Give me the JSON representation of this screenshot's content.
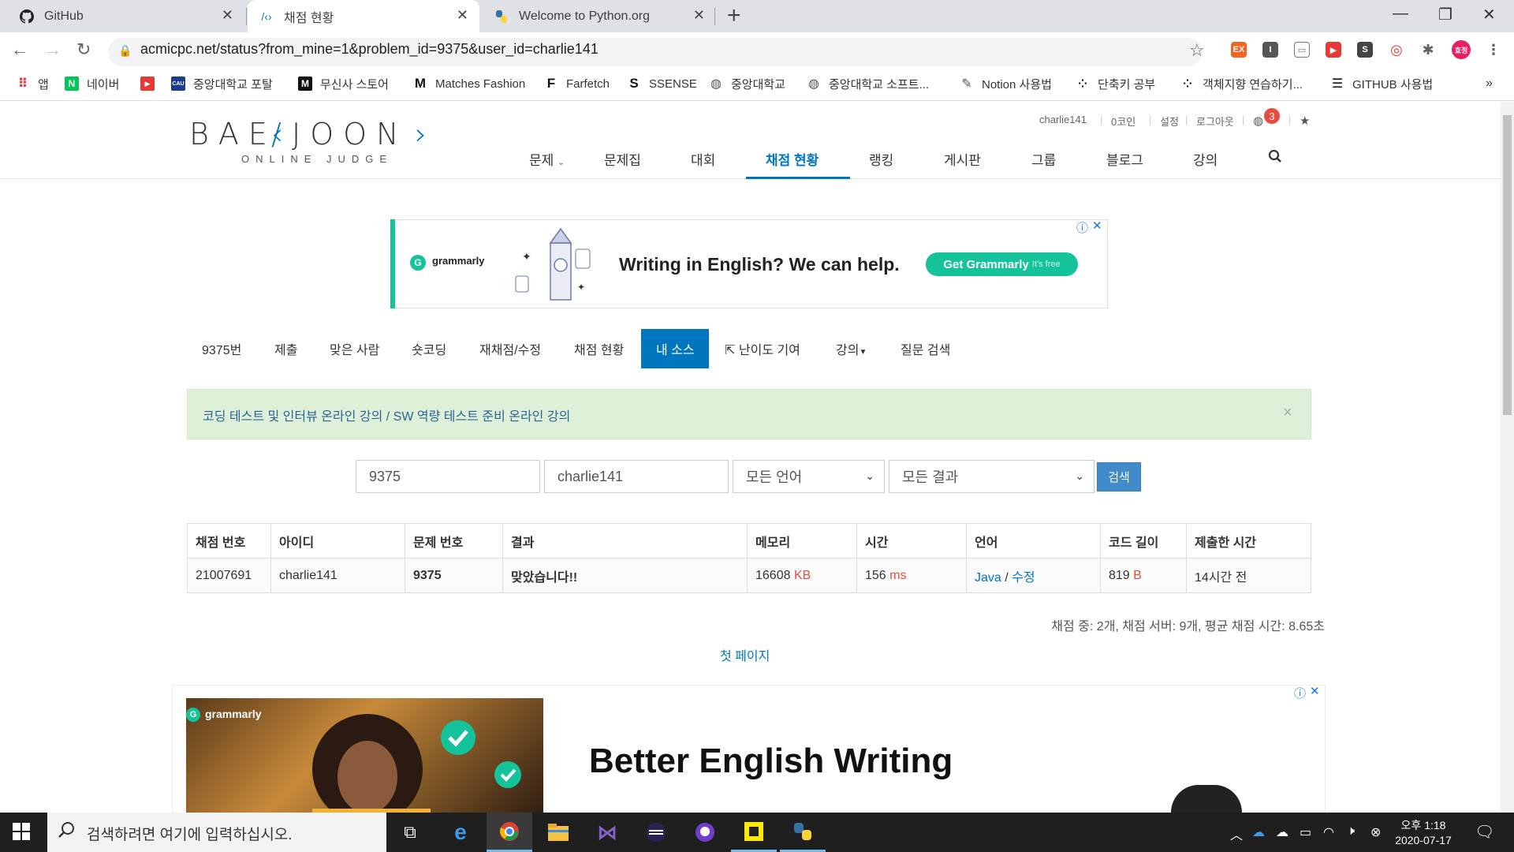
{
  "browser": {
    "tabs": [
      {
        "title": "GitHub",
        "icon": "github-icon",
        "active": false
      },
      {
        "title": "채점 현황",
        "icon": "code-icon",
        "active": true
      },
      {
        "title": "Welcome to Python.org",
        "icon": "python-icon",
        "active": false
      }
    ],
    "url": "acmicpc.net/status?from_mine=1&problem_id=9375&user_id=charlie141",
    "profile_label": "효정",
    "ext_labels": [
      "EX",
      "I",
      "S"
    ],
    "bookmarks": [
      {
        "label": "앱",
        "icon": "apps-grid-icon"
      },
      {
        "label": "네이버",
        "icon": "naver-icon"
      },
      {
        "label": "",
        "icon": "youtube-icon"
      },
      {
        "label": "중앙대학교 포탈",
        "icon": "cau-icon"
      },
      {
        "label": "무신사 스토어",
        "icon": "musinsa-icon"
      },
      {
        "label": "Matches Fashion",
        "icon": "matches-icon"
      },
      {
        "label": "Farfetch",
        "icon": "farfetch-icon"
      },
      {
        "label": "SSENSE",
        "icon": "ssense-icon"
      },
      {
        "label": "중앙대학교",
        "icon": "globe-icon"
      },
      {
        "label": "중앙대학교 소프트...",
        "icon": "globe-icon"
      },
      {
        "label": "Notion 사용법",
        "icon": "notion-icon"
      },
      {
        "label": "단축키 공부",
        "icon": "dots-icon"
      },
      {
        "label": "객체지향 연습하기...",
        "icon": "dots-icon"
      },
      {
        "label": "GITHUB 사용법",
        "icon": "stack-icon"
      }
    ],
    "bookmarks_more": "»"
  },
  "site": {
    "logo_main": "BAEKJOON",
    "logo_sub": "ONLINE JUDGE",
    "user_links": [
      "charlie141",
      "0코인",
      "설정",
      "로그아웃"
    ],
    "notification_count": "3",
    "main_nav": [
      "문제",
      "문제집",
      "대회",
      "채점 현황",
      "랭킹",
      "게시판",
      "그룹",
      "블로그",
      "강의"
    ],
    "active_nav": "채점 현황"
  },
  "ad_top": {
    "brand": "grammarly",
    "headline": "Writing in English? We can help.",
    "cta": "Get Grammarly",
    "cta_sub": "It's free"
  },
  "subnav": [
    "9375번",
    "제출",
    "맞은 사람",
    "숏코딩",
    "재채점/수정",
    "채점 현황",
    "내 소스",
    "난이도 기여",
    "강의",
    "질문 검색"
  ],
  "subnav_active": "내 소스",
  "alert": {
    "text": "코딩 테스트 및 인터뷰 온라인 강의 / SW 역량 테스트 준비 온라인 강의",
    "close": "×"
  },
  "filters": {
    "problem_id": "9375",
    "user_id": "charlie141",
    "language": "모든 언어",
    "result": "모든 결과",
    "search_label": "검색"
  },
  "table": {
    "headers": [
      "채점 번호",
      "아이디",
      "문제 번호",
      "결과",
      "메모리",
      "시간",
      "언어",
      "코드 길이",
      "제출한 시간"
    ],
    "rows": [
      {
        "submission_id": "21007691",
        "user": "charlie141",
        "problem": "9375",
        "result": "맞았습니다!!",
        "memory": "16608",
        "memory_unit": "KB",
        "time": "156",
        "time_unit": "ms",
        "language": "Java",
        "lang_sep": "/",
        "edit": "수정",
        "code_length": "819",
        "code_unit": "B",
        "submitted": "14시간 전"
      }
    ]
  },
  "stats": "채점 중: 2개, 채점 서버: 9개, 평균 채점 시간: 8.65초",
  "first_page": "첫 페이지",
  "ad_bottom": {
    "brand": "grammarly",
    "headline": "Better English Writing"
  },
  "taskbar": {
    "search_placeholder": "검색하려면 여기에 입력하십시오.",
    "clock_time": "오후 1:18",
    "clock_date": "2020-07-17"
  }
}
